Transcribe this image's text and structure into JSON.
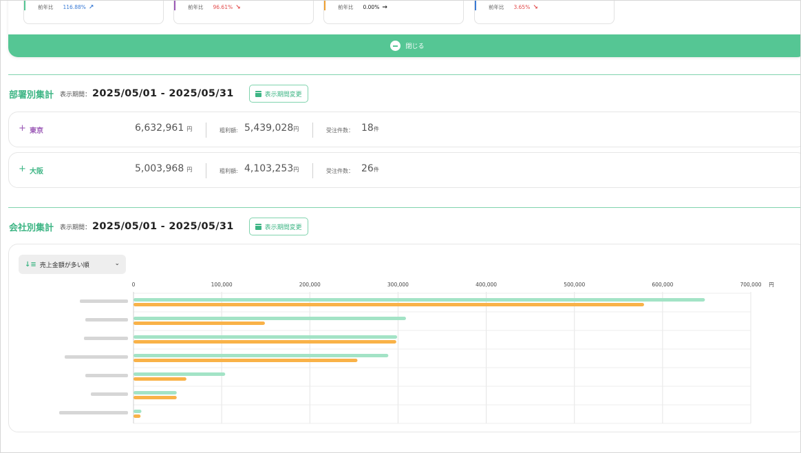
{
  "summary_cards": [
    {
      "label": "前年比",
      "value": "116.88%",
      "arrow": "↗",
      "color": "#3a7bd5",
      "bar": "#55c694"
    },
    {
      "label": "前年比",
      "value": "96.61%",
      "arrow": "↘",
      "color": "#e24b4b",
      "bar": "#9b59b6"
    },
    {
      "label": "前年比",
      "value": "0.00%",
      "arrow": "→",
      "color": "#222222",
      "bar": "#f0a030"
    },
    {
      "label": "前年比",
      "value": "3.65%",
      "arrow": "↘",
      "color": "#e24b4b",
      "bar": "#3a7bd5"
    }
  ],
  "close_button": {
    "label": "閉じる"
  },
  "department_section": {
    "title": "部署別集計",
    "period_label": "表示期間：",
    "period_value": "2025/05/01 - 2025/05/31",
    "change_button": "表示期間変更",
    "rows": [
      {
        "plus": "+",
        "name": "東京",
        "name_color": "#9b59b6",
        "amount": "6,632,961",
        "yen": "円",
        "gross_label": "粗利額:",
        "gross_value": "5,439,028",
        "gross_yen": "円",
        "orders_label": "受注件数：",
        "orders_value": "18",
        "orders_unit": "件"
      },
      {
        "plus": "+",
        "name": "大阪",
        "name_color": "#3db584",
        "amount": "5,003,968",
        "yen": "円",
        "gross_label": "粗利額:",
        "gross_value": "4,103,253",
        "gross_yen": "円",
        "orders_label": "受注件数：",
        "orders_value": "26",
        "orders_unit": "件"
      }
    ]
  },
  "company_section": {
    "title": "会社別集計",
    "period_label": "表示期間：",
    "period_value": "2025/05/01 - 2025/05/31",
    "change_button": "表示期間変更",
    "sort_select": {
      "label": "売上金額が多い順",
      "icon": "sort-descending-icon"
    }
  },
  "chart_data": {
    "type": "bar",
    "orientation": "horizontal",
    "unit": "円",
    "xlim": [
      0,
      700000
    ],
    "ticks": [
      "0",
      "100,000",
      "200,000",
      "300,000",
      "400,000",
      "500,000",
      "600,000",
      "700,000"
    ],
    "categories": [
      "",
      "",
      "",
      "",
      "",
      "",
      ""
    ],
    "categories_note_blurred": true,
    "series": [
      {
        "color": "#a3e3c6",
        "values": [
          648000,
          309000,
          299000,
          289000,
          104000,
          49000,
          9000
        ]
      },
      {
        "color": "#f9b248",
        "values": [
          579000,
          149000,
          298000,
          254000,
          60000,
          49000,
          8000
        ]
      }
    ],
    "grid": true,
    "legend": "none"
  },
  "colors": {
    "accent": "#55c694",
    "accent_text": "#3db584",
    "orange": "#f9b248",
    "green_light": "#a3e3c6"
  }
}
